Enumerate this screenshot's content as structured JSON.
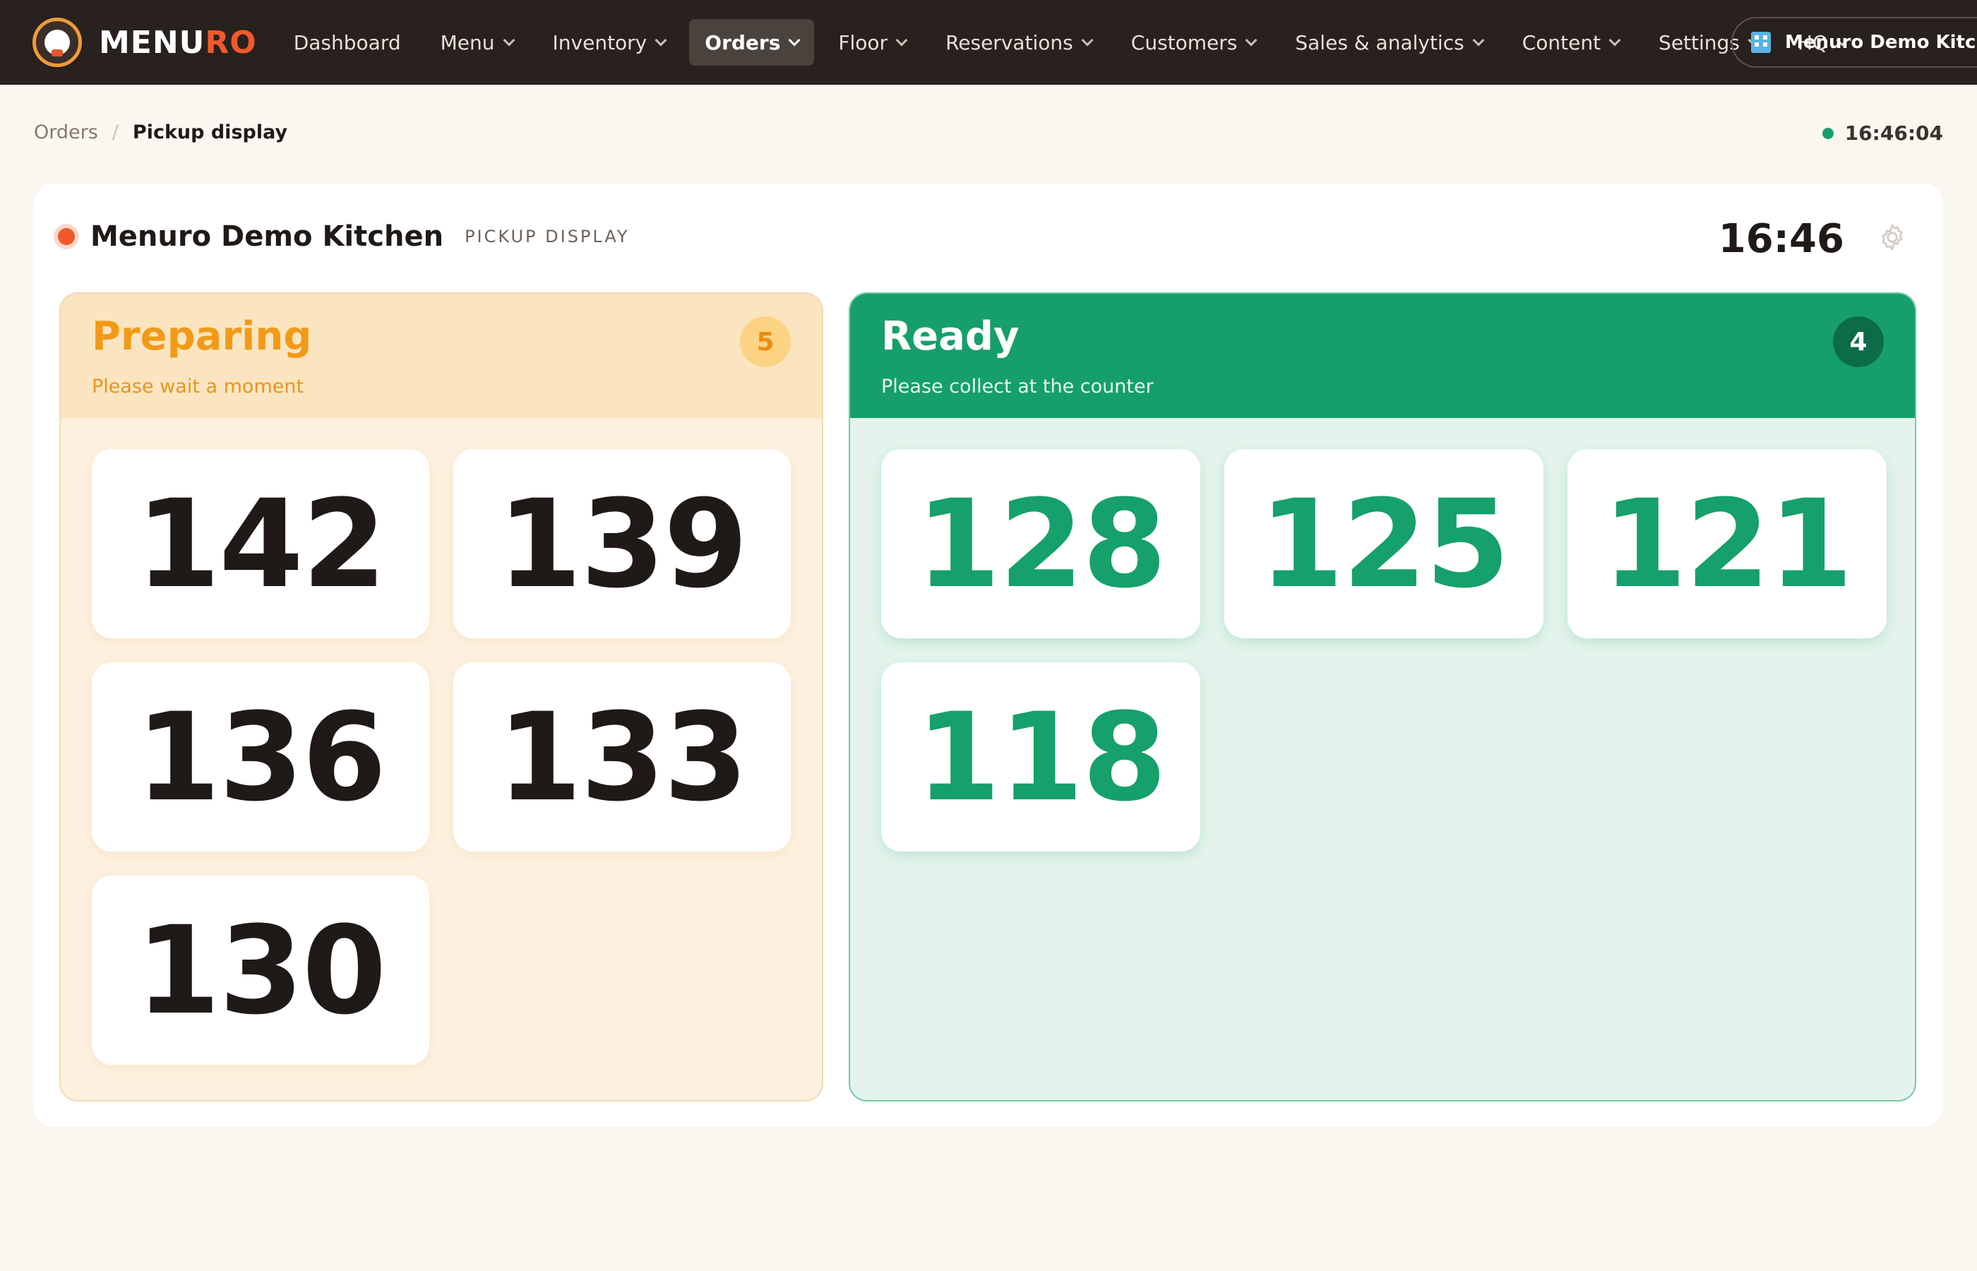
{
  "brand": {
    "name_primary": "MENU",
    "name_accent": "RO"
  },
  "nav": {
    "items": [
      {
        "label": "Dashboard",
        "dropdown": false,
        "active": false
      },
      {
        "label": "Menu",
        "dropdown": true,
        "active": false
      },
      {
        "label": "Inventory",
        "dropdown": true,
        "active": false
      },
      {
        "label": "Orders",
        "dropdown": true,
        "active": true
      },
      {
        "label": "Floor",
        "dropdown": true,
        "active": false
      },
      {
        "label": "Reservations",
        "dropdown": true,
        "active": false
      },
      {
        "label": "Customers",
        "dropdown": true,
        "active": false
      },
      {
        "label": "Sales & analytics",
        "dropdown": true,
        "active": false
      },
      {
        "label": "Content",
        "dropdown": true,
        "active": false
      },
      {
        "label": "Settings",
        "dropdown": true,
        "active": false
      },
      {
        "label": "HQ",
        "dropdown": true,
        "active": false
      }
    ],
    "store_label": "Menuro Demo Kitchen",
    "store_icon": "building-icon"
  },
  "breadcrumb": {
    "parent": "Orders",
    "separator": "/",
    "current": "Pickup display"
  },
  "clock": {
    "time": "16:46:04"
  },
  "panel": {
    "kitchen_name": "Menuro Demo Kitchen",
    "display_label": "PICKUP DISPLAY",
    "time": "16:46"
  },
  "preparing": {
    "title": "Preparing",
    "subtitle": "Please wait a moment",
    "count": "5",
    "orders": [
      "142",
      "139",
      "136",
      "133",
      "130"
    ]
  },
  "ready": {
    "title": "Ready",
    "subtitle": "Please collect at the counter",
    "count": "4",
    "orders": [
      "128",
      "125",
      "121",
      "118"
    ]
  },
  "colors": {
    "topbar": "#28211d",
    "accent_orange": "#ef5a2b",
    "preparing_accent": "#f29a18",
    "ready_green": "#16a06b"
  }
}
